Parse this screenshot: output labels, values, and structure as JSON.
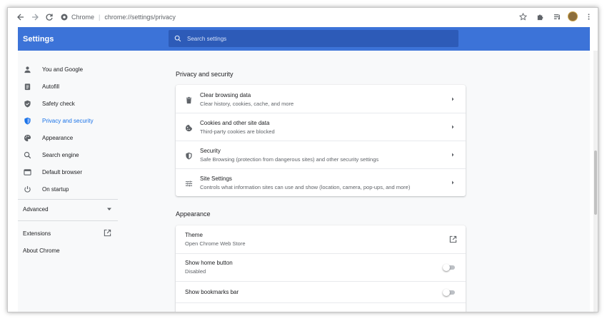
{
  "toolbar": {
    "site_label": "Chrome",
    "url": "chrome://settings/privacy"
  },
  "header": {
    "title": "Settings",
    "search_placeholder": "Search settings"
  },
  "sidebar": {
    "items": [
      {
        "label": "You and Google",
        "icon": "person-icon"
      },
      {
        "label": "Autofill",
        "icon": "clipboard-icon"
      },
      {
        "label": "Safety check",
        "icon": "shield-check-icon"
      },
      {
        "label": "Privacy and security",
        "icon": "shield-icon",
        "active": true
      },
      {
        "label": "Appearance",
        "icon": "palette-icon"
      },
      {
        "label": "Search engine",
        "icon": "search-icon"
      },
      {
        "label": "Default browser",
        "icon": "browser-icon"
      },
      {
        "label": "On startup",
        "icon": "power-icon"
      }
    ],
    "advanced_label": "Advanced",
    "extensions_label": "Extensions",
    "about_label": "About Chrome"
  },
  "privacy": {
    "section_title": "Privacy and security",
    "rows": [
      {
        "title": "Clear browsing data",
        "subtitle": "Clear history, cookies, cache, and more",
        "icon": "trash-icon"
      },
      {
        "title": "Cookies and other site data",
        "subtitle": "Third-party cookies are blocked",
        "icon": "cookie-icon"
      },
      {
        "title": "Security",
        "subtitle": "Safe Browsing (protection from dangerous sites) and other security settings",
        "icon": "shield-icon"
      },
      {
        "title": "Site Settings",
        "subtitle": "Controls what information sites can use and show (location, camera, pop-ups, and more)",
        "icon": "sliders-icon"
      }
    ]
  },
  "appearance": {
    "section_title": "Appearance",
    "theme_title": "Theme",
    "theme_subtitle": "Open Chrome Web Store",
    "home_button_title": "Show home button",
    "home_button_subtitle": "Disabled",
    "bookmarks_bar_title": "Show bookmarks bar"
  },
  "colors": {
    "header_blue": "#3c73d8",
    "active_blue": "#1a73e8"
  }
}
